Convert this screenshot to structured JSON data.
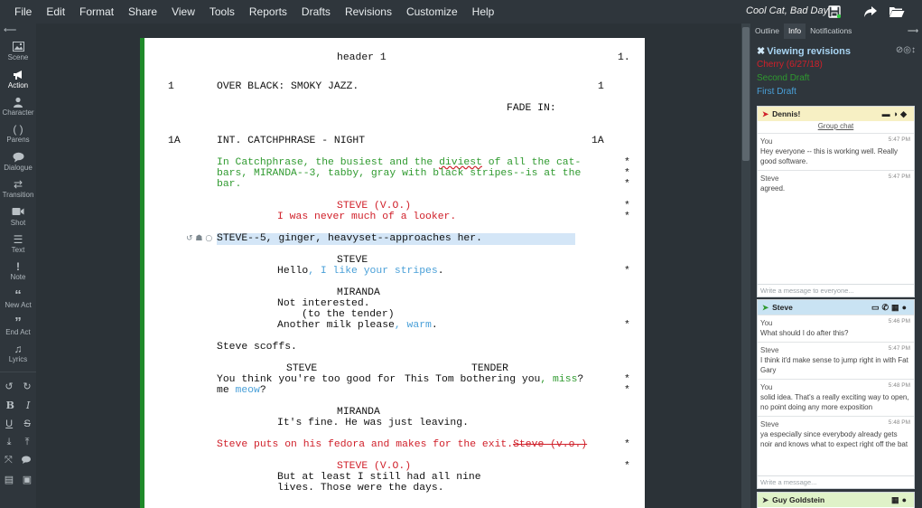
{
  "menu": [
    "File",
    "Edit",
    "Format",
    "Share",
    "View",
    "Tools",
    "Reports",
    "Drafts",
    "Revisions",
    "Customize",
    "Help"
  ],
  "doc_title": "Cool Cat, Bad Day",
  "left_toolbar": {
    "collapse": "⟵",
    "tools": [
      {
        "label": "Scene",
        "icon": "image-icon"
      },
      {
        "label": "Action",
        "icon": "megaphone-icon"
      },
      {
        "label": "Character",
        "icon": "person-icon"
      },
      {
        "label": "Parens",
        "icon": "parens-icon"
      },
      {
        "label": "Dialogue",
        "icon": "speech-bubble-icon"
      },
      {
        "label": "Transition",
        "icon": "arrows-icon"
      },
      {
        "label": "Shot",
        "icon": "video-camera-icon"
      },
      {
        "label": "Text",
        "icon": "lines-icon"
      },
      {
        "label": "Note",
        "icon": "exclamation-icon"
      },
      {
        "label": "New Act",
        "icon": "open-quote-icon"
      },
      {
        "label": "End Act",
        "icon": "close-quote-icon"
      },
      {
        "label": "Lyrics",
        "icon": "music-note-icon"
      }
    ]
  },
  "script": {
    "header": "header 1",
    "page_number": "1.",
    "scene1_number": "1",
    "scene1_heading": "OVER BLACK: SMOKY JAZZ.",
    "transition": "FADE IN:",
    "scene1a_number": "1A",
    "scene1a_heading": "INT. CATCHPHRASE - NIGHT",
    "action1_line1_pre": "In Catchphrase, the busiest and the ",
    "action1_line1_word": "diviest",
    "action1_line1_post": " of all the cat-",
    "action1_line2": "bars, MIRANDA--3, tabby, gray with black stripes--is at the",
    "action1_line3": "bar.",
    "char1": "STEVE (V.O.)",
    "dial1": "I was never much of a looker.",
    "action2": "STEVE--5, ginger, heavyset--approaches her.",
    "char2": "STEVE",
    "dial2_pre": "Hello",
    "dial2_post": ", I like your stripes",
    "dial2_end": ".",
    "char3": "MIRANDA",
    "dial3_line1": "Not interested.",
    "paren3": "(to the tender)",
    "dial3_line2_pre": "Another milk please",
    "dial3_line2_post": ", warm",
    "dial3_line2_end": ".",
    "action3": "Steve scoffs.",
    "dual_left_char": "STEVE",
    "dual_right_char": "TENDER",
    "dual_left_line1": "You think you're too good for",
    "dual_left_line2_pre": "me ",
    "dual_left_line2_word": "meow",
    "dual_left_line2_end": "?",
    "dual_right_line1_pre": "This Tom bothering you",
    "dual_right_line1_post": ", miss",
    "dual_right_line1_end": "?",
    "char4": "MIRANDA",
    "dial4": "It's fine. He was just leaving.",
    "action4": "Steve puts on his fedora and makes for the exit.",
    "action4_strike": "Steve (v.o.)",
    "char5": "STEVE (V.O.)",
    "dial5_line1": "But at least I still had all nine",
    "dial5_line2": "lives. Those were the days.",
    "star": "*"
  },
  "right_panel": {
    "tabs": [
      "Outline",
      "Info",
      "Notifications"
    ],
    "active_tab": "Info",
    "revisions_title": "Viewing revisions",
    "revisions": [
      {
        "name": "Cherry (6/27/18)",
        "color": "#d0202a"
      },
      {
        "name": "Second Draft",
        "color": "#2f9a2f"
      },
      {
        "name": "First Draft",
        "color": "#4aa0d8"
      }
    ],
    "chats": [
      {
        "name": "Dennis!",
        "color": "#f7f0c4",
        "subtitle": "Group chat",
        "messages": [
          {
            "author": "You",
            "time": "5:47 PM",
            "text": "Hey everyone -- this is working well. Really good software."
          },
          {
            "author": "Steve",
            "time": "5:47 PM",
            "text": "agreed."
          }
        ],
        "placeholder": "Write a message to everyone..."
      },
      {
        "name": "Steve",
        "color": "#c9e3f3",
        "messages": [
          {
            "author": "You",
            "time": "5:46 PM",
            "text": "What should I do after this?"
          },
          {
            "author": "Steve",
            "time": "5:47 PM",
            "text": "I think it'd make sense to jump right in with Fat Gary"
          },
          {
            "author": "You",
            "time": "5:48 PM",
            "text": "solid idea. That's a really exciting way to open, no point doing any more exposition"
          },
          {
            "author": "Steve",
            "time": "5:48 PM",
            "text": "ya especially since everybody already gets noir and knows what to expect right off the bat"
          }
        ],
        "placeholder": "Write a message..."
      },
      {
        "name": "Guy Goldstein",
        "color": "#dff2c8"
      }
    ]
  }
}
